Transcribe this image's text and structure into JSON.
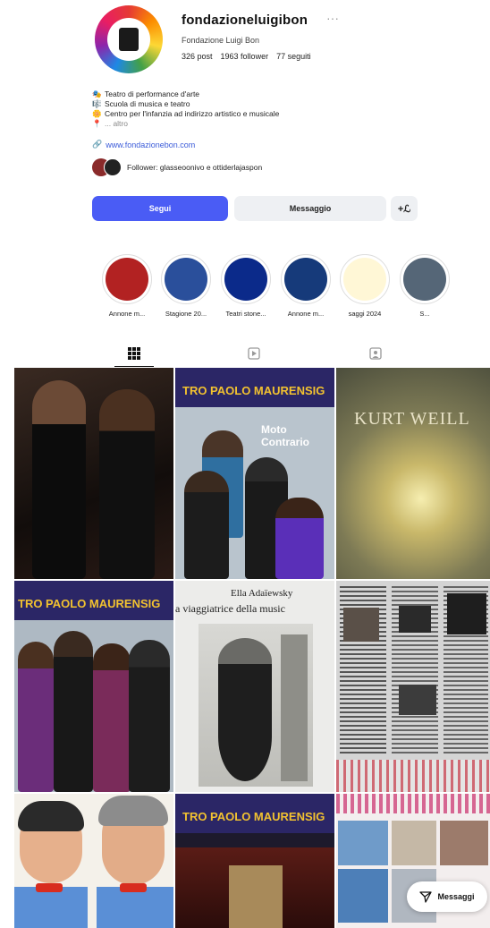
{
  "profile": {
    "username": "fondazioneluigibon",
    "more_label": "···",
    "fullname": "Fondazione Luigi Bon",
    "posts": "326 post",
    "followers": "1963 follower",
    "following": "77 seguiti"
  },
  "bio": {
    "line1": "Teatro di performance d'arte",
    "line2": "Scuola di musica e teatro",
    "line3": "Centro per l'infanzia ad indirizzo artistico e musicale",
    "more": "... altro",
    "link": "www.fondazionebon.com"
  },
  "followers_line": "Follower: glasseoonivo e ottiderlajaspon",
  "buttons": {
    "follow": "Segui",
    "message": "Messaggio",
    "add": "+ℒ"
  },
  "highlights": [
    {
      "label": "Annone m...",
      "color": "#b22222"
    },
    {
      "label": "Stagione 20...",
      "color": "#2a4f9b"
    },
    {
      "label": "Teatri stone...",
      "color": "#0b2a8a"
    },
    {
      "label": "Annone m...",
      "color": "#163a7a"
    },
    {
      "label": "saggi 2024",
      "color": "#fff7d6"
    },
    {
      "label": "S...",
      "color": "#556677"
    }
  ],
  "tabs": {
    "grid_icon": "grid-icon",
    "reels_icon": "reels-icon",
    "tagged_icon": "tagged-icon"
  },
  "grid": {
    "post2_title": "TRO PAOLO MAURENSIG",
    "post2_sub": "Moto Contrario",
    "post3_title": "KURT WEILL",
    "post4_title": "TRO PAOLO MAURENSIG",
    "post5_title": "Ella Adaïewsky",
    "post5_sub": "a viaggiatrice della music",
    "post8_title": "TRO PAOLO MAURENSIG"
  },
  "messages_button": "Messaggi",
  "colors": {
    "accent": "#4a5cf5",
    "link": "#3b5bd9"
  }
}
